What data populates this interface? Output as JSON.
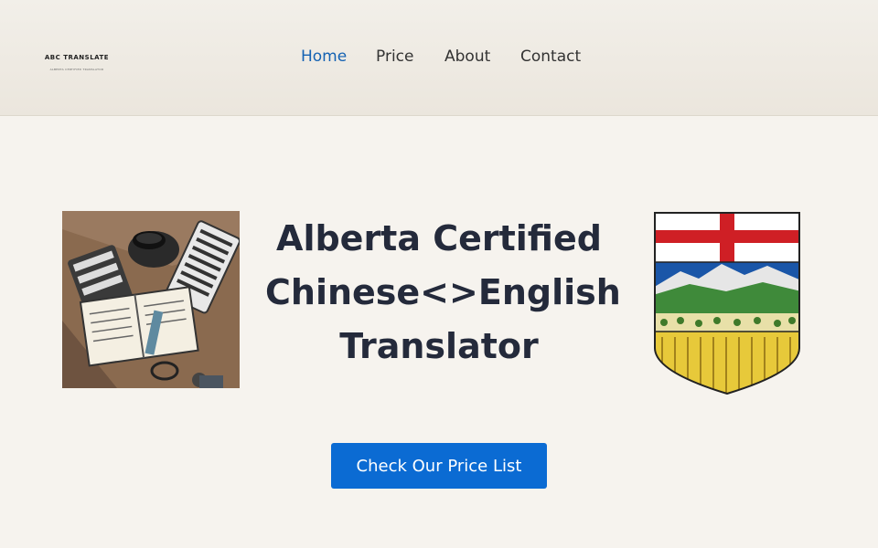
{
  "logo": {
    "name": "ABC TRANSLATE",
    "tagline": "ALBERTA CERTIFIED TRANSLATOR"
  },
  "nav": {
    "items": [
      {
        "label": "Home",
        "active": true
      },
      {
        "label": "Price",
        "active": false
      },
      {
        "label": "About",
        "active": false
      },
      {
        "label": "Contact",
        "active": false
      }
    ]
  },
  "hero": {
    "headline": "Alberta Certified Chinese<>English Translator",
    "cta_label": "Check Our Price List"
  },
  "colors": {
    "accent": "#0b6bd3",
    "nav_active": "#1462b3",
    "background": "#f6f3ee",
    "headline": "#242a3b"
  }
}
